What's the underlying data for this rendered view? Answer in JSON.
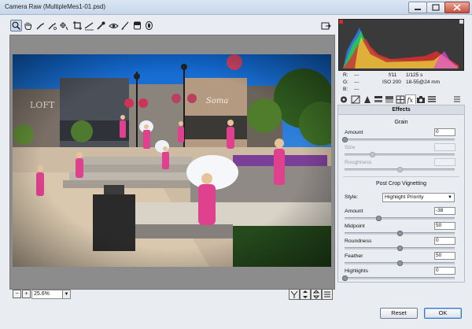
{
  "window": {
    "title": "Camera Raw (MultipleMes1-01.psd)"
  },
  "toolbar": {
    "tools": [
      "zoom-tool",
      "hand-tool",
      "white-balance-tool",
      "color-sampler-tool",
      "targeted-adjustment-tool",
      "crop-tool",
      "straighten-tool",
      "spot-removal-tool",
      "red-eye-removal-tool",
      "adjustment-brush-tool",
      "graduated-filter-tool",
      "radial-filter-tool"
    ]
  },
  "status": {
    "zoom": "25.6%"
  },
  "info": {
    "r_label": "R:",
    "g_label": "G:",
    "b_label": "B:",
    "r_value": "---",
    "g_value": "---",
    "b_value": "---",
    "aperture": "f/11",
    "shutter": "1/125 s",
    "iso": "ISO 200",
    "lens": "18-55@24 mm"
  },
  "panel": {
    "title": "Effects",
    "grain": {
      "heading": "Grain",
      "amount_label": "Amount",
      "amount_value": "0",
      "size_label": "Size",
      "roughness_label": "Roughness"
    },
    "vignette": {
      "heading": "Post Crop Vignetting",
      "style_label": "Style:",
      "style_value": "Highlight Priority",
      "amount_label": "Amount",
      "amount_value": "-38",
      "midpoint_label": "Midpoint",
      "midpoint_value": "50",
      "roundness_label": "Roundness",
      "roundness_value": "0",
      "feather_label": "Feather",
      "feather_value": "50",
      "highlights_label": "Highlights",
      "highlights_value": "0"
    },
    "slider_levels": {
      "grain_amount": 0,
      "grain_size": 0.25,
      "grain_roughness": 0.5,
      "vignette_amount": 0.31,
      "vignette_midpoint": 0.5,
      "vignette_roundness": 0.5,
      "vignette_feather": 0.5,
      "vignette_highlights": 0
    }
  },
  "buttons": {
    "reset": "Reset",
    "ok": "OK"
  },
  "colors": {
    "sky": "#1e7fd8",
    "accent": "#3d78c4",
    "dress": "#e0418f"
  }
}
